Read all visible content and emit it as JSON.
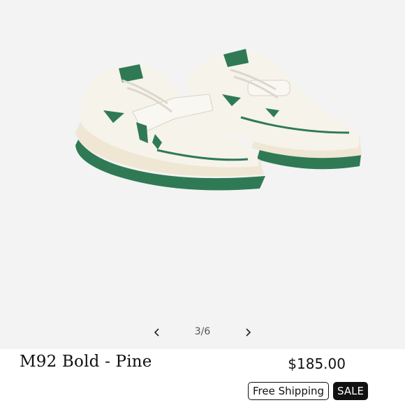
{
  "product": {
    "name": "M92 Bold - Pine",
    "price": "$185.00",
    "image_alt": "Pair of off-white leather sneakers with pine green accents and green rubber sole"
  },
  "gallery": {
    "counter": "3/6",
    "prev_icon": "chevron-left-icon",
    "next_icon": "chevron-right-icon"
  },
  "badges": {
    "shipping": "Free Shipping",
    "sale": "SALE"
  },
  "colors": {
    "accent_green": "#2f7a55",
    "sole_cream": "#efe6d4",
    "upper_white": "#f6f3ea",
    "background": "#f3f3f3"
  }
}
